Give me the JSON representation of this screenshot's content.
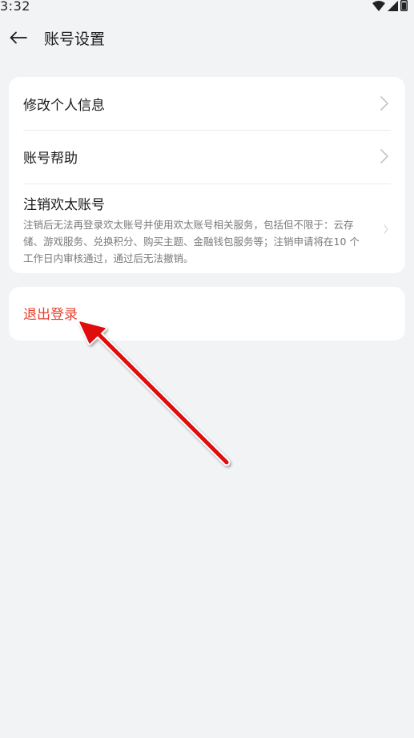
{
  "status_bar": {
    "time": "3:32",
    "icons": [
      "wifi-icon",
      "signal-icon",
      "battery-icon"
    ]
  },
  "header": {
    "back_icon": "arrow-left-icon",
    "title": "账号设置"
  },
  "settings": {
    "items": [
      {
        "label": "修改个人信息",
        "icon": "chevron-right-icon"
      },
      {
        "label": "账号帮助",
        "icon": "chevron-right-icon"
      },
      {
        "label": "注销欢太账号",
        "description": "注销后无法再登录欢太账号并使用欢太账号相关服务，包括但不限于：云存储、游戏服务、兑换积分、购买主题、金融钱包服务等；注销申请将在10 个工作日内审核通过，通过后无法撤销。",
        "icon": "chevron-right-icon"
      }
    ]
  },
  "logout": {
    "label": "退出登录",
    "color": "#e8402e"
  },
  "annotation": {
    "type": "red-arrow",
    "color": "#e01010",
    "points_to": "退出登录"
  }
}
